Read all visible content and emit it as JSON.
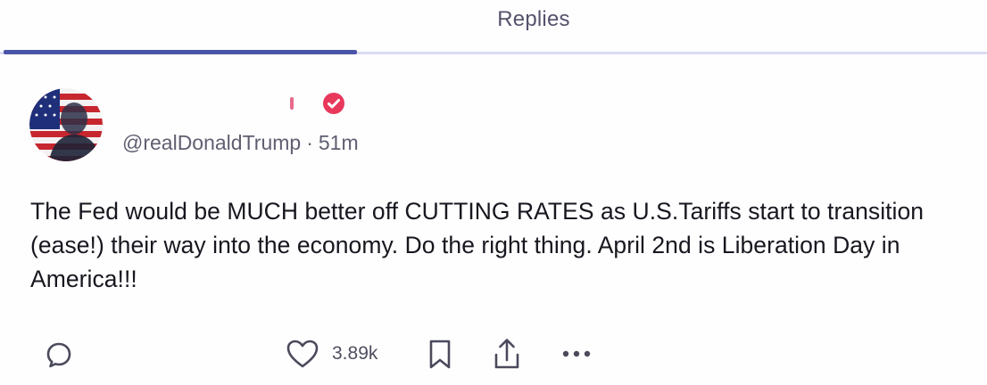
{
  "tabs": {
    "active_label": "Replies"
  },
  "post": {
    "name_mark": "!",
    "handle": "@realDonaldTrump",
    "separator": "·",
    "time": "51m",
    "text": "The Fed would be MUCH better off CUTTING RATES as U.S.Tariffs start to transition (ease!) their way into the economy. Do the right thing. April 2nd is Liberation Day in America!!!",
    "verified_color": "#e8385c"
  },
  "actions": {
    "reply_icon": "reply-icon",
    "like_icon": "heart-icon",
    "like_count": "3.89k",
    "bookmark_icon": "bookmark-icon",
    "share_icon": "share-icon",
    "more_icon": "more-icon"
  },
  "colors": {
    "tab_indicator": "#4a55a8",
    "tab_track": "#d9dcf2",
    "text": "#17171f",
    "muted": "#5f5f70"
  }
}
